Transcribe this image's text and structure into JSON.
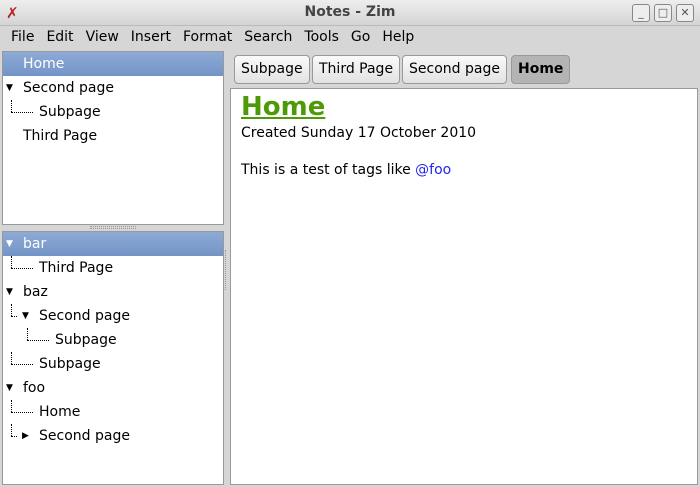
{
  "window": {
    "title": "Notes - Zim"
  },
  "menu": [
    "File",
    "Edit",
    "View",
    "Insert",
    "Format",
    "Search",
    "Tools",
    "Go",
    "Help"
  ],
  "index_tree": [
    {
      "label": "Home",
      "level": 0,
      "selected": true
    },
    {
      "label": "Second page",
      "level": 0,
      "expanded": true
    },
    {
      "label": "Subpage",
      "level": 1
    },
    {
      "label": "Third Page",
      "level": 0
    }
  ],
  "tag_tree": [
    {
      "label": "bar",
      "level": 0,
      "expanded": true,
      "selected": true
    },
    {
      "label": "Third Page",
      "level": 1
    },
    {
      "label": "baz",
      "level": 0,
      "expanded": true
    },
    {
      "label": "Second page",
      "level": 1,
      "expanded": true
    },
    {
      "label": "Subpage",
      "level": 2
    },
    {
      "label": "Subpage",
      "level": 1
    },
    {
      "label": "foo",
      "level": 0,
      "expanded": true
    },
    {
      "label": "Home",
      "level": 1
    },
    {
      "label": "Second page",
      "level": 1,
      "expanded": false
    }
  ],
  "pathbar": [
    "Subpage",
    "Third Page",
    "Second page",
    "Home"
  ],
  "page": {
    "title": "Home",
    "created": "Created Sunday 17 October 2010",
    "text": "This is a test of tags like ",
    "tag": "@foo"
  }
}
